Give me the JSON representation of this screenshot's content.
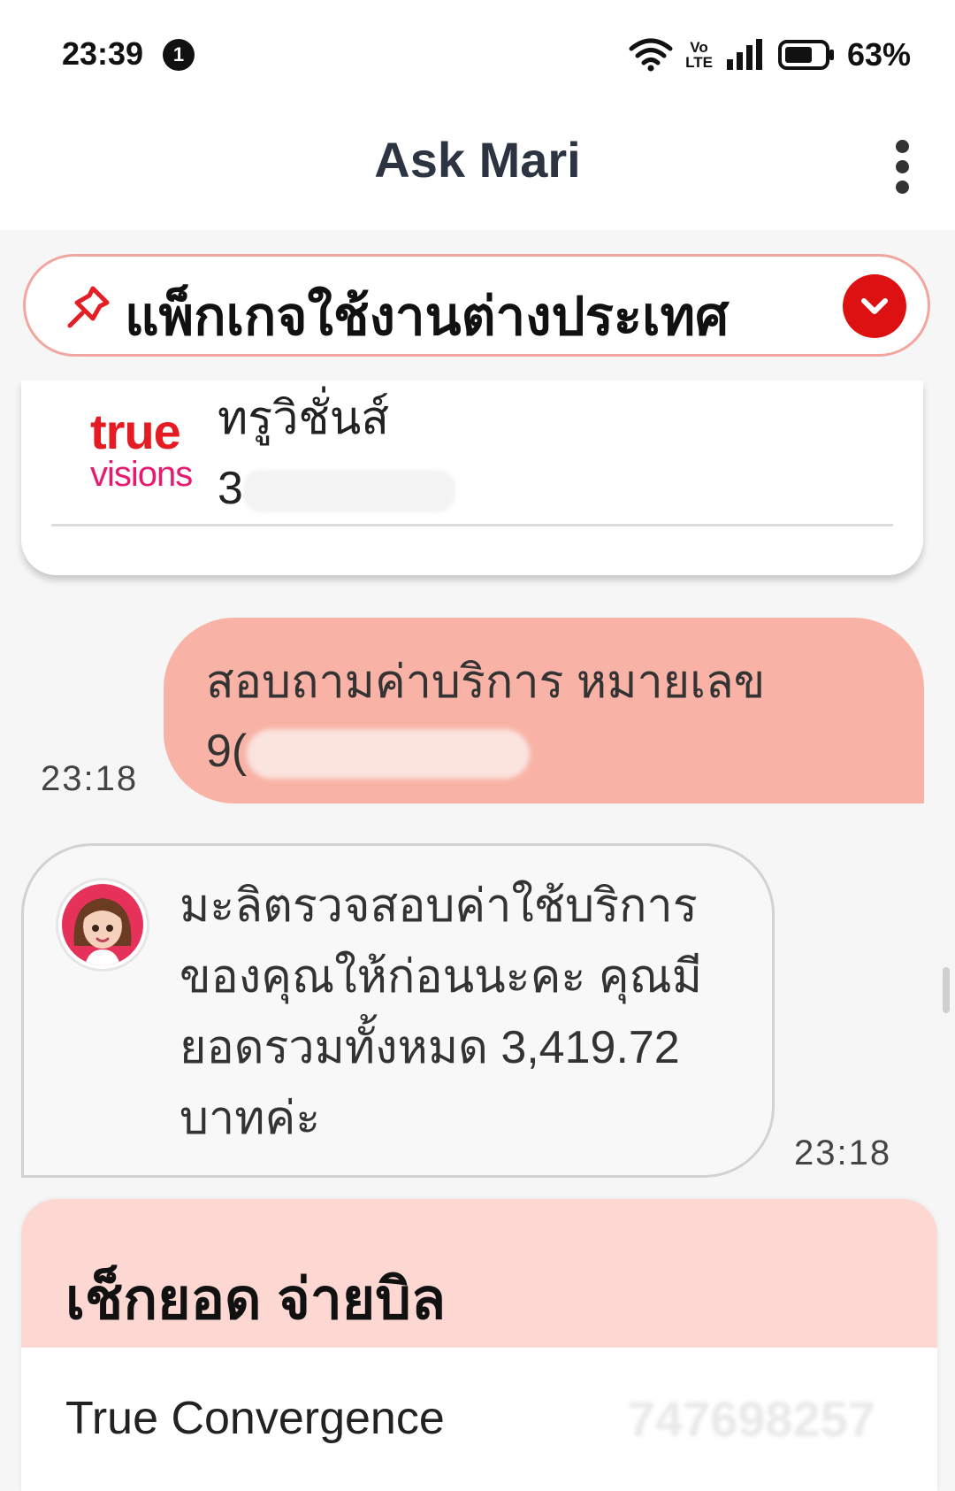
{
  "status_bar": {
    "time": "23:39",
    "notification_count": "1",
    "volte_top": "Vo",
    "volte_bottom": "LTE",
    "battery_percent": "63%"
  },
  "app_bar": {
    "title": "Ask Mari"
  },
  "pinned_banner": {
    "label": "แพ็กเกจใช้งานต่างประเทศ"
  },
  "account_card": {
    "brand_top": "true",
    "brand_bottom": "visions",
    "name": "ทรูวิชั่นส์",
    "number_visible": "3"
  },
  "user_message": {
    "line1": "สอบถามค่าบริการ หมายเลข",
    "number_visible": "9(",
    "time": "23:18"
  },
  "bot_message": {
    "text": "มะลิตรวจสอบค่าใช้บริการของคุณให้ก่อนนะคะ คุณมียอดรวมทั้งหมด 3,419.72 บาทค่ะ",
    "time": "23:18"
  },
  "bill_card": {
    "title": "เช็กยอด จ่ายบิล",
    "row_label": "True Convergence",
    "row_number": "747698257"
  },
  "colors": {
    "accent_red": "#dd1111",
    "user_bubble": "#f8b3a6",
    "bill_header": "#fdd7d2"
  }
}
